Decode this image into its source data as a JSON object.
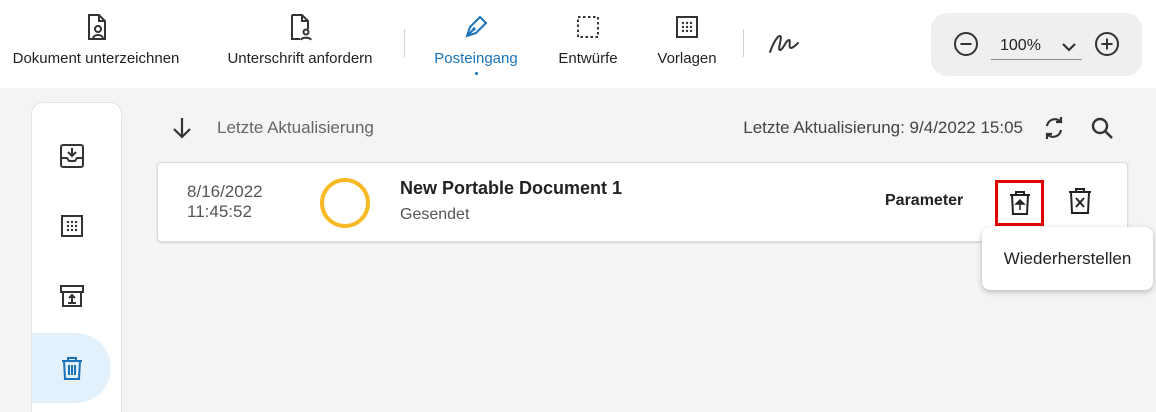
{
  "toolbar": {
    "items": [
      {
        "label": "Dokument unterzeichnen",
        "icon": "document-user-icon"
      },
      {
        "label": "Unterschrift anfordern",
        "icon": "document-users-icon"
      },
      {
        "label": "Posteingang",
        "icon": "pen-icon",
        "active": true
      },
      {
        "label": "Entwürfe",
        "icon": "dashed-square-icon"
      },
      {
        "label": "Vorlagen",
        "icon": "dotted-grid-icon"
      }
    ],
    "signature_icon": "signature-icon"
  },
  "zoom": {
    "value": "100%"
  },
  "sidebar": {
    "items": [
      {
        "icon": "inbox-download-icon"
      },
      {
        "icon": "dotted-grid-icon"
      },
      {
        "icon": "archive-icon"
      },
      {
        "icon": "trash-icon",
        "active": true
      }
    ]
  },
  "list_header": {
    "sort_label": "Letzte Aktualisierung",
    "last_update": "Letzte Aktualisierung:  9/4/2022 15:05"
  },
  "document": {
    "date": "8/16/2022",
    "time": "11:45:52",
    "title": "New Portable Document 1",
    "status": "Gesendet",
    "status_color": "#f7b924",
    "parameter_label": "Parameter"
  },
  "tooltip": {
    "text": "Wiederherstellen"
  },
  "colors": {
    "accent": "#1a73b8",
    "highlight": "#e00000"
  }
}
